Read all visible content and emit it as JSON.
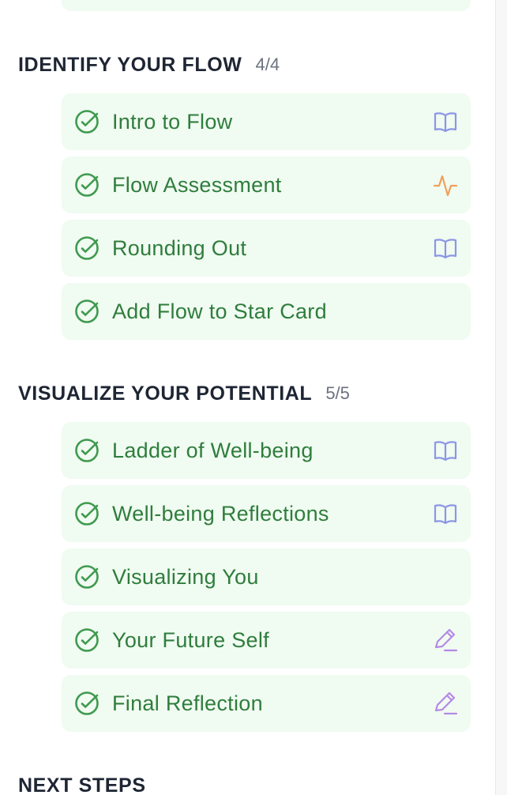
{
  "colors": {
    "card_bg": "#f0fbf1",
    "complete_green": "#2f7d3d",
    "check_green": "#3f9a4f",
    "reading_icon": "#8c96e6",
    "activity_icon": "#f0a05a",
    "writing_icon": "#b58ae6",
    "heading": "#1e2533",
    "count": "#6b7280"
  },
  "sections": [
    {
      "title": "IDENTIFY YOUR FLOW",
      "count": "4/4",
      "steps": [
        {
          "label": "Intro to Flow",
          "status": "complete",
          "type_icon": "book-icon"
        },
        {
          "label": "Flow Assessment",
          "status": "complete",
          "type_icon": "activity-pulse-icon"
        },
        {
          "label": "Rounding Out",
          "status": "complete",
          "type_icon": "book-icon"
        },
        {
          "label": "Add Flow to Star Card",
          "status": "complete",
          "type_icon": ""
        }
      ]
    },
    {
      "title": "VISUALIZE YOUR POTENTIAL",
      "count": "5/5",
      "steps": [
        {
          "label": "Ladder of Well-being",
          "status": "complete",
          "type_icon": "book-icon"
        },
        {
          "label": "Well-being Reflections",
          "status": "complete",
          "type_icon": "book-icon"
        },
        {
          "label": "Visualizing You",
          "status": "complete",
          "type_icon": ""
        },
        {
          "label": "Your Future Self",
          "status": "complete",
          "type_icon": "pencil-icon"
        },
        {
          "label": "Final Reflection",
          "status": "complete",
          "type_icon": "pencil-icon"
        }
      ]
    },
    {
      "title": "NEXT STEPS",
      "count": "",
      "steps": []
    }
  ]
}
